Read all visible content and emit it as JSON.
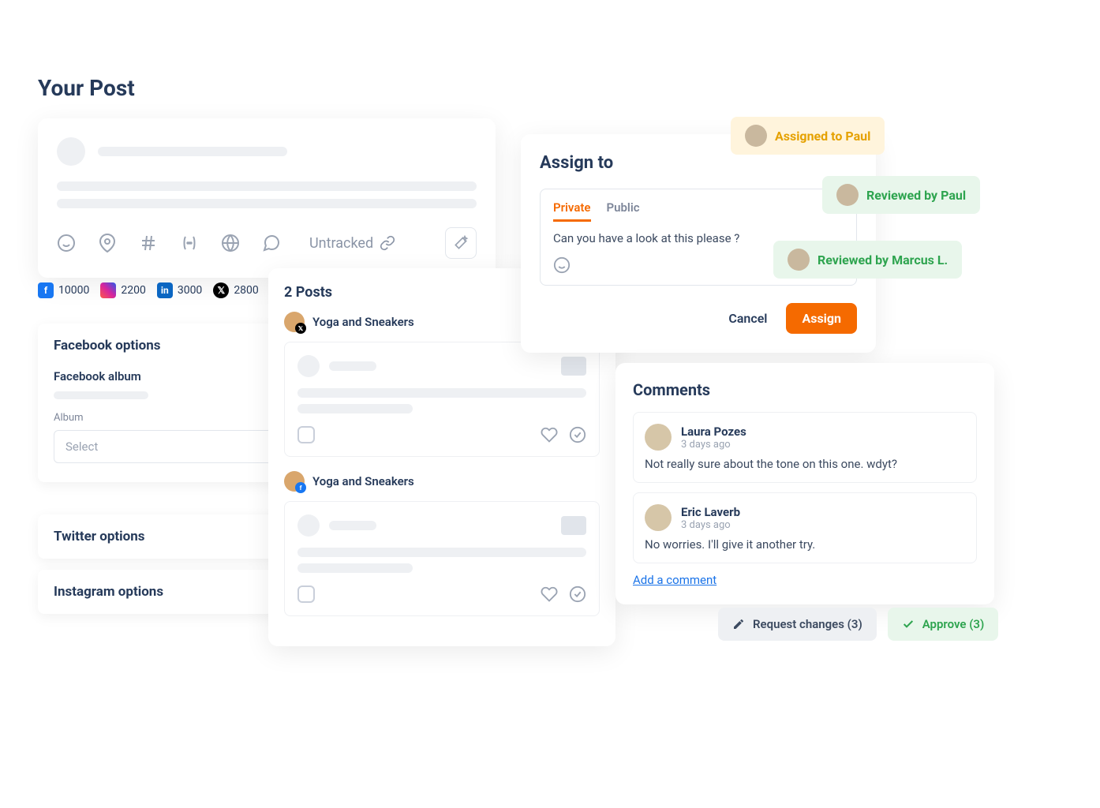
{
  "page": {
    "heading": "Your Post"
  },
  "composer": {
    "untracked_label": "Untracked",
    "social_counts": {
      "fb": "10000",
      "ig": "2200",
      "li": "3000",
      "x": "2800"
    }
  },
  "fb_options": {
    "title": "Facebook options",
    "subtitle": "Facebook album",
    "album_label": "Album",
    "select_placeholder": "Select"
  },
  "tw_options": {
    "title": "Twitter options"
  },
  "ig_options": {
    "title": "Instagram options"
  },
  "posts_panel": {
    "title": "2 Posts",
    "posts": [
      {
        "source": "Yoga and Sneakers",
        "platform": "x"
      },
      {
        "source": "Yoga and Sneakers",
        "platform": "fb"
      }
    ]
  },
  "assign": {
    "title": "Assign to",
    "tabs": {
      "private": "Private",
      "public": "Public"
    },
    "message": "Can you have a look at this please ?",
    "cancel_label": "Cancel",
    "assign_label": "Assign"
  },
  "chips": {
    "assigned": "Assigned to Paul",
    "reviewed1": "Reviewed by Paul",
    "reviewed2": "Reviewed by Marcus L."
  },
  "comments": {
    "title": "Comments",
    "items": [
      {
        "author": "Laura Pozes",
        "time": "3 days ago",
        "text": "Not really sure about the tone on this one. wdyt?"
      },
      {
        "author": "Eric Laverb",
        "time": "3 days ago",
        "text": "No worries. I'll give it another try."
      }
    ],
    "add_label": "Add a comment"
  },
  "review": {
    "request_label": "Request changes (3)",
    "approve_label": "Approve (3)"
  }
}
